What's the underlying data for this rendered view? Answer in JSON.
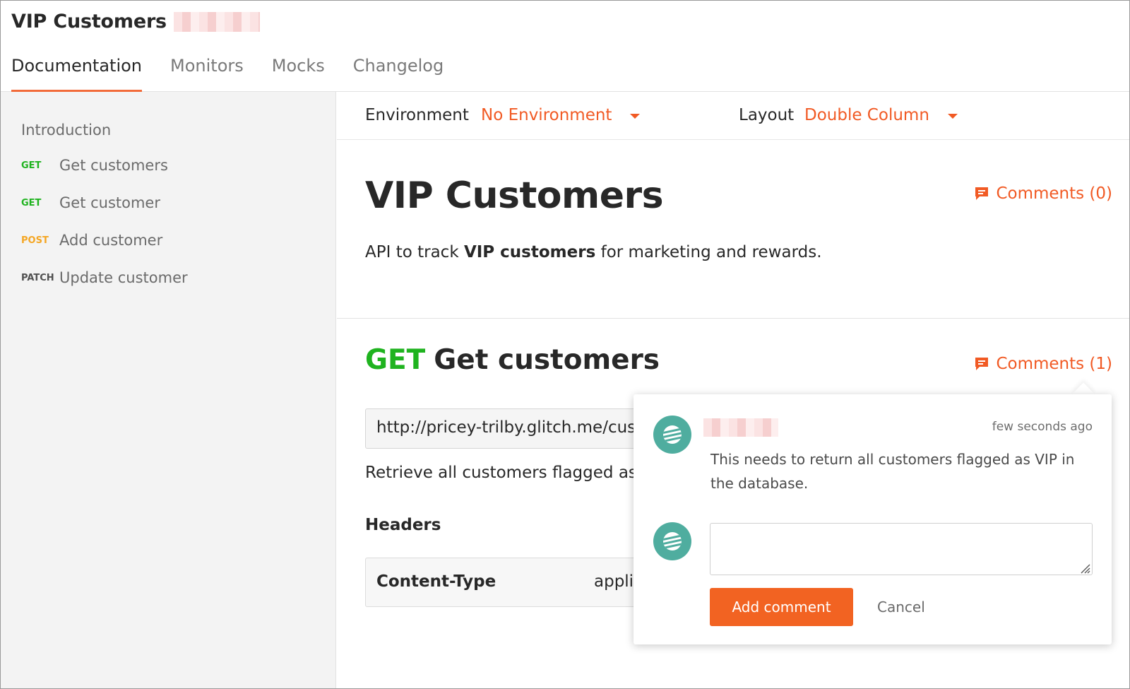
{
  "app": {
    "title": "VIP Customers"
  },
  "tabs": [
    {
      "label": "Documentation",
      "active": true
    },
    {
      "label": "Monitors",
      "active": false
    },
    {
      "label": "Mocks",
      "active": false
    },
    {
      "label": "Changelog",
      "active": false
    }
  ],
  "sidebar": {
    "intro_label": "Introduction",
    "items": [
      {
        "method": "GET",
        "label": "Get customers",
        "method_color": "#1fb31f"
      },
      {
        "method": "GET",
        "label": "Get customer",
        "method_color": "#1fb31f"
      },
      {
        "method": "POST",
        "label": "Add customer",
        "method_color": "#f4a623"
      },
      {
        "method": "PATCH",
        "label": "Update customer",
        "method_color": "#505050"
      }
    ]
  },
  "toolbar": {
    "environment_label": "Environment",
    "environment_value": "No Environment",
    "layout_label": "Layout",
    "layout_value": "Double Column"
  },
  "doc": {
    "title": "VIP Customers",
    "comments_label": "Comments (0)",
    "desc_prefix": "API to track ",
    "desc_bold": "VIP customers",
    "desc_suffix": " for marketing and rewards."
  },
  "request": {
    "method": "GET",
    "name": "Get customers",
    "comments_label": "Comments (1)",
    "url": "http://pricey-trilby.glitch.me/customers",
    "description": "Retrieve all customers flagged as VIP",
    "headers_title": "Headers",
    "headers": [
      {
        "key": "Content-Type",
        "value": "application/json"
      }
    ]
  },
  "comment_popover": {
    "timestamp": "few seconds ago",
    "comment_text": "This needs to return all customers flagged as VIP in the database.",
    "input_value": "",
    "add_button_label": "Add comment",
    "cancel_button_label": "Cancel"
  },
  "colors": {
    "accent": "#f15a24",
    "get": "#1fb31f",
    "post": "#f4a623",
    "patch": "#505050",
    "avatar": "#4fad9f"
  }
}
